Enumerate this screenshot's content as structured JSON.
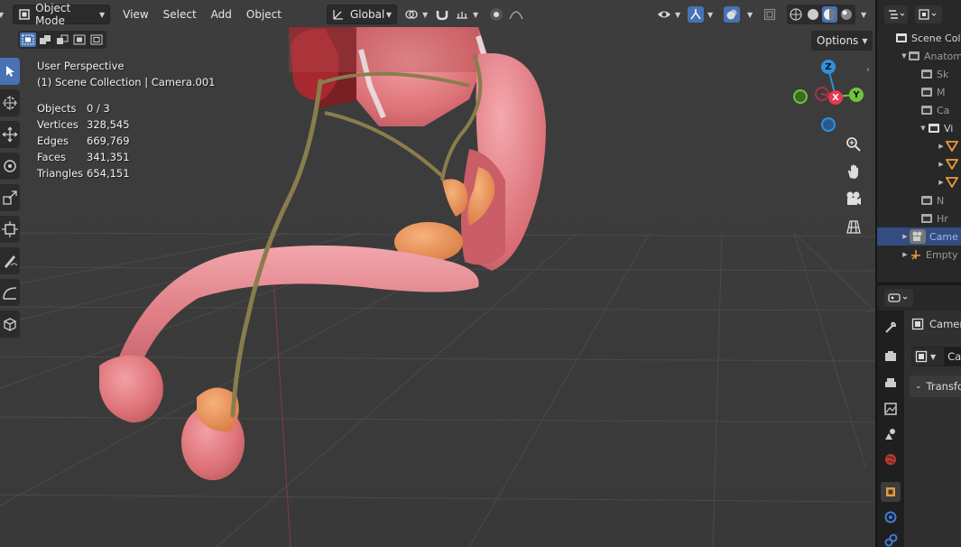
{
  "header": {
    "mode_label": "Object Mode",
    "menus": [
      "View",
      "Select",
      "Add",
      "Object"
    ],
    "orientation_label": "Global",
    "options_label": "Options"
  },
  "viewport": {
    "perspective": "User Perspective",
    "collection": "(1) Scene Collection | Camera.001",
    "stats": [
      {
        "label": "Objects",
        "value": "0 / 3"
      },
      {
        "label": "Vertices",
        "value": "328,545"
      },
      {
        "label": "Edges",
        "value": "669,769"
      },
      {
        "label": "Faces",
        "value": "341,351"
      },
      {
        "label": "Triangles",
        "value": "654,151"
      }
    ],
    "gizmo": {
      "z": "Z",
      "y": "Y",
      "x": "X"
    }
  },
  "toolbar": {
    "tools": [
      "select-box-tool",
      "cursor-tool",
      "move-tool",
      "rotate-tool",
      "scale-tool",
      "transform-tool",
      "annotate-tool",
      "measure-tool",
      "add-cube-tool"
    ]
  },
  "outliner": {
    "items": [
      {
        "label": "Scene Col",
        "icon": "collection-icon"
      },
      {
        "label": "Anatom",
        "icon": "collection-icon"
      },
      {
        "label": "Sk",
        "icon": "collection-icon"
      },
      {
        "label": "M",
        "icon": "collection-icon"
      },
      {
        "label": "Ca",
        "icon": "collection-icon"
      },
      {
        "label": "Vi",
        "icon": "collection-icon"
      },
      {
        "label": "",
        "icon": "mesh-icon"
      },
      {
        "label": "",
        "icon": "mesh-icon"
      },
      {
        "label": "",
        "icon": "mesh-icon"
      },
      {
        "label": "N",
        "icon": "collection-icon"
      },
      {
        "label": "Hr",
        "icon": "collection-icon"
      },
      {
        "label": "Came",
        "icon": "camera-icon"
      },
      {
        "label": "Empty",
        "icon": "empty-icon"
      }
    ]
  },
  "properties": {
    "object_name": "Camer",
    "data_name": "Can",
    "panel_label": "Transfo"
  },
  "colors": {
    "accent": "#4772b3",
    "selection": "#334d80",
    "flesh": "#e07a7d",
    "gland": "#ef9a62",
    "duct": "#8a7d4d",
    "gizmo_x": "#e8384f",
    "gizmo_y": "#6ec43a",
    "gizmo_z": "#2e8fe0"
  }
}
